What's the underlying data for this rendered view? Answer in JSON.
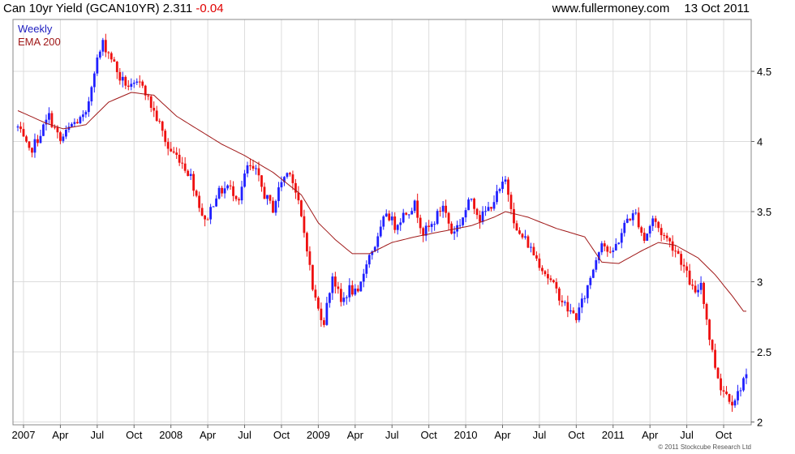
{
  "header": {
    "title": "Can 10yr Yield (GCAN10YR) 2.311",
    "change": "-0.04",
    "website": "www.fullermoney.com",
    "date": "13 Oct 2011"
  },
  "footer": {
    "credit": "© 2011 Stockcube Research Ltd"
  },
  "colors": {
    "up": "#2020ff",
    "down": "#ee1010",
    "ema": "#a01818",
    "grid": "#dcdcdc",
    "frame": "#888888",
    "legend_weekly": "#2020c0",
    "legend_ema": "#a01818"
  },
  "chart_data": {
    "type": "candlestick",
    "title": "Can 10yr Yield (GCAN10YR)",
    "last_value": 2.311,
    "last_change": -0.04,
    "interval": "Weekly",
    "y_axis_side": "right",
    "ylim": [
      1.98,
      4.87
    ],
    "yticks": [
      2,
      2.5,
      3,
      3.5,
      4,
      4.5
    ],
    "ytick_labels": [
      "2",
      "2.5",
      "3",
      "3.5",
      "4",
      "4.5"
    ],
    "grid": true,
    "legend_position": "top-left",
    "x_start_week": 0,
    "x_end_week": 257,
    "xticks": [
      {
        "label": "2007",
        "week": 2
      },
      {
        "label": "Apr",
        "week": 15
      },
      {
        "label": "Jul",
        "week": 28
      },
      {
        "label": "Oct",
        "week": 41
      },
      {
        "label": "2008",
        "week": 54
      },
      {
        "label": "Apr",
        "week": 67
      },
      {
        "label": "Jul",
        "week": 80
      },
      {
        "label": "Oct",
        "week": 93
      },
      {
        "label": "2009",
        "week": 106
      },
      {
        "label": "Apr",
        "week": 119
      },
      {
        "label": "Jul",
        "week": 132
      },
      {
        "label": "Oct",
        "week": 145
      },
      {
        "label": "2010",
        "week": 158
      },
      {
        "label": "Apr",
        "week": 171
      },
      {
        "label": "Jul",
        "week": 184
      },
      {
        "label": "Oct",
        "week": 197
      },
      {
        "label": "2011",
        "week": 210
      },
      {
        "label": "Apr",
        "week": 223
      },
      {
        "label": "Jul",
        "week": 236
      },
      {
        "label": "Oct",
        "week": 249
      }
    ],
    "series": [
      {
        "name": "Weekly",
        "kind": "candles"
      },
      {
        "name": "EMA 200",
        "kind": "line"
      }
    ],
    "close_anchors": [
      [
        0,
        4.1
      ],
      [
        4,
        3.92
      ],
      [
        7,
        4.02
      ],
      [
        11,
        4.18
      ],
      [
        15,
        4.0
      ],
      [
        19,
        4.12
      ],
      [
        24,
        4.18
      ],
      [
        27,
        4.52
      ],
      [
        30,
        4.7
      ],
      [
        33,
        4.6
      ],
      [
        36,
        4.45
      ],
      [
        40,
        4.38
      ],
      [
        44,
        4.42
      ],
      [
        46,
        4.3
      ],
      [
        50,
        4.12
      ],
      [
        53,
        3.95
      ],
      [
        57,
        3.88
      ],
      [
        61,
        3.75
      ],
      [
        64,
        3.55
      ],
      [
        66,
        3.42
      ],
      [
        70,
        3.62
      ],
      [
        74,
        3.68
      ],
      [
        78,
        3.6
      ],
      [
        81,
        3.82
      ],
      [
        84,
        3.78
      ],
      [
        87,
        3.62
      ],
      [
        90,
        3.52
      ],
      [
        93,
        3.72
      ],
      [
        96,
        3.8
      ],
      [
        99,
        3.55
      ],
      [
        102,
        3.25
      ],
      [
        104,
        2.95
      ],
      [
        106,
        2.8
      ],
      [
        108,
        2.72
      ],
      [
        111,
        3.05
      ],
      [
        114,
        2.85
      ],
      [
        117,
        2.95
      ],
      [
        120,
        2.9
      ],
      [
        123,
        3.15
      ],
      [
        127,
        3.3
      ],
      [
        130,
        3.5
      ],
      [
        133,
        3.4
      ],
      [
        136,
        3.48
      ],
      [
        140,
        3.55
      ],
      [
        143,
        3.35
      ],
      [
        146,
        3.4
      ],
      [
        150,
        3.55
      ],
      [
        153,
        3.35
      ],
      [
        156,
        3.42
      ],
      [
        160,
        3.6
      ],
      [
        163,
        3.45
      ],
      [
        166,
        3.52
      ],
      [
        170,
        3.65
      ],
      [
        172,
        3.72
      ],
      [
        174,
        3.55
      ],
      [
        176,
        3.35
      ],
      [
        179,
        3.3
      ],
      [
        182,
        3.2
      ],
      [
        185,
        3.1
      ],
      [
        188,
        3.0
      ],
      [
        191,
        2.9
      ],
      [
        194,
        2.8
      ],
      [
        197,
        2.75
      ],
      [
        200,
        2.9
      ],
      [
        203,
        3.1
      ],
      [
        206,
        3.3
      ],
      [
        209,
        3.18
      ],
      [
        212,
        3.3
      ],
      [
        215,
        3.45
      ],
      [
        218,
        3.48
      ],
      [
        221,
        3.3
      ],
      [
        224,
        3.45
      ],
      [
        227,
        3.35
      ],
      [
        230,
        3.28
      ],
      [
        233,
        3.2
      ],
      [
        236,
        3.05
      ],
      [
        239,
        2.9
      ],
      [
        241,
        3.0
      ],
      [
        244,
        2.6
      ],
      [
        246,
        2.4
      ],
      [
        248,
        2.25
      ],
      [
        250,
        2.2
      ],
      [
        252,
        2.15
      ],
      [
        254,
        2.2
      ],
      [
        256,
        2.31
      ]
    ],
    "ema200_anchors": [
      [
        0,
        4.22
      ],
      [
        10,
        4.13
      ],
      [
        16,
        4.09
      ],
      [
        24,
        4.12
      ],
      [
        32,
        4.28
      ],
      [
        40,
        4.35
      ],
      [
        48,
        4.33
      ],
      [
        56,
        4.18
      ],
      [
        64,
        4.08
      ],
      [
        72,
        3.98
      ],
      [
        80,
        3.9
      ],
      [
        90,
        3.78
      ],
      [
        100,
        3.62
      ],
      [
        106,
        3.42
      ],
      [
        112,
        3.3
      ],
      [
        118,
        3.2
      ],
      [
        124,
        3.2
      ],
      [
        132,
        3.28
      ],
      [
        140,
        3.32
      ],
      [
        150,
        3.36
      ],
      [
        160,
        3.4
      ],
      [
        168,
        3.46
      ],
      [
        172,
        3.5
      ],
      [
        180,
        3.46
      ],
      [
        190,
        3.38
      ],
      [
        200,
        3.32
      ],
      [
        206,
        3.14
      ],
      [
        212,
        3.13
      ],
      [
        220,
        3.22
      ],
      [
        226,
        3.28
      ],
      [
        232,
        3.26
      ],
      [
        240,
        3.17
      ],
      [
        246,
        3.05
      ],
      [
        252,
        2.9
      ],
      [
        256,
        2.79
      ]
    ]
  }
}
